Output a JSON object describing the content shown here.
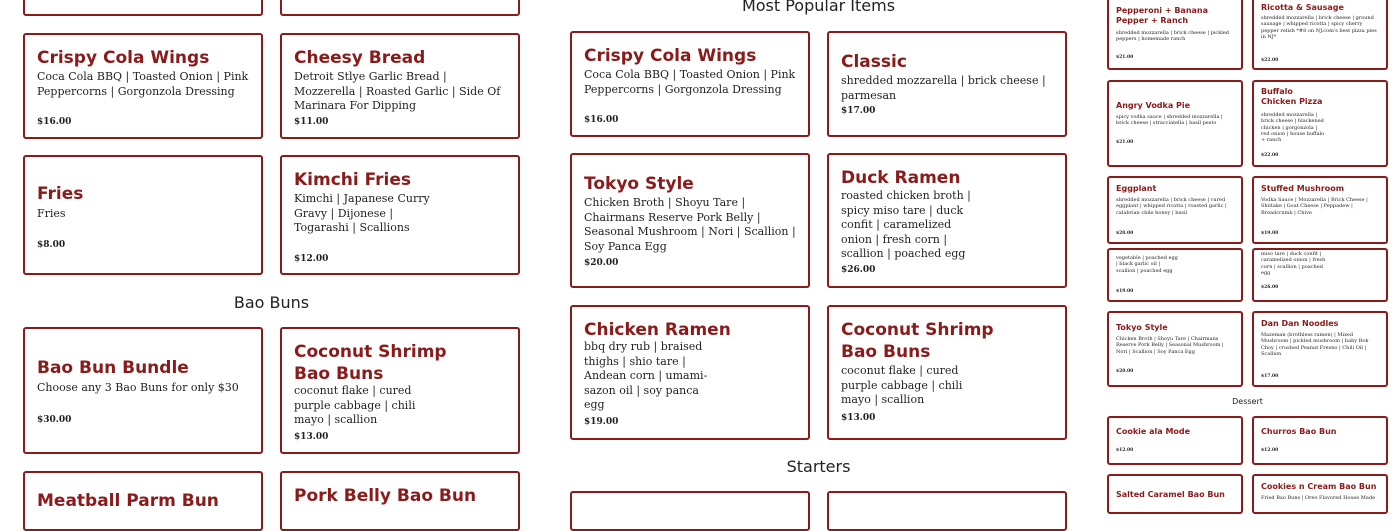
{
  "left": {
    "bao_heading": "Bao Buns",
    "cards": [
      {
        "name": "Crispy Cola Wings",
        "desc": "Coca Cola BBQ | Toasted Onion | Pink Peppercorns | Gorgonzola Dressing",
        "price": "$16.00"
      },
      {
        "name": "Cheesy Bread",
        "desc": "Detroit Stlye Garlic Bread | Mozzerella | Roasted Garlic | Side Of Marinara For Dipping",
        "price": "$11.00"
      },
      {
        "name": "Fries",
        "desc": "Fries",
        "price": "$8.00"
      },
      {
        "name": "Kimchi Fries",
        "desc": "Kimchi | Japanese Curry Gravy | Dijonese | Togarashi | Scallions",
        "price": "$12.00"
      },
      {
        "name": "Bao Bun Bundle",
        "desc": "Choose any 3 Bao Buns for only $30",
        "price": "$30.00"
      },
      {
        "name": "Coconut Shrimp Bao Buns",
        "desc": "coconut flake | cured purple cabbage | chili mayo | scallion",
        "price": "$13.00"
      },
      {
        "name": "Meatball Parm Bun",
        "desc": "",
        "price": ""
      },
      {
        "name": "Pork Belly Bao Bun",
        "desc": "",
        "price": ""
      }
    ]
  },
  "middle": {
    "popular_heading": "Most Popular Items",
    "starters_heading": "Starters",
    "cards": [
      {
        "name": "Crispy Cola Wings",
        "desc": "Coca Cola BBQ | Toasted Onion | Pink Peppercorns | Gorgonzola Dressing",
        "price": "$16.00"
      },
      {
        "name": "Classic",
        "desc": "shredded mozzarella | brick cheese | parmesan",
        "price": "$17.00"
      },
      {
        "name": "Tokyo Style",
        "desc": "Chicken Broth | Shoyu Tare | Chairmans Reserve Pork Belly | Seasonal Mushroom | Nori | Scallion | Soy Panca Egg",
        "price": "$20.00"
      },
      {
        "name": "Duck Ramen",
        "desc": "roasted chicken broth | spicy miso tare | duck confit | caramelized onion | fresh corn | scallion | poached egg",
        "price": "$26.00"
      },
      {
        "name": "Chicken Ramen",
        "desc": "bbq dry rub | braised thighs | shio tare | Andean corn | umami-sazon oil | soy panca egg",
        "price": "$19.00"
      },
      {
        "name": "Coconut Shrimp Bao Buns",
        "desc": "coconut flake | cured purple cabbage | chili mayo | scallion",
        "price": "$13.00"
      },
      {
        "name": "",
        "desc": "",
        "price": ""
      },
      {
        "name": "",
        "desc": "",
        "price": ""
      }
    ]
  },
  "right": {
    "dessert_heading": "Dessert",
    "cards": [
      {
        "name": "Pepperoni + Banana Pepper + Ranch",
        "desc": "shredded mozzarella | brick cheese | pickled peppers | homemade ranch",
        "price": "$21.00"
      },
      {
        "name": "Ricotta & Sausage",
        "desc": "shredded mozzarella | brick cheese | ground sausage | whipped ricotta | spicy cherry pepper relish *#8 on NJ.com's best pizza pies in NJ*",
        "price": "$22.00"
      },
      {
        "name": "Angry Vodka Pie",
        "desc": "spicy vodka sauce | shredded mozzarella | brick cheese | stracciatella | basil pesto",
        "price": "$21.00"
      },
      {
        "name": "Buffalo Chicken Pizza",
        "desc": "shredded mozzarella | brick cheese | blackened chicken | gorgonzola | red onion | house buffalo + ranch",
        "price": "$22.00"
      },
      {
        "name": "Eggplant",
        "desc": "shredded mozzarella | brick cheese | cured eggplant | whipped ricotta | roasted garlic | calabrian chile honey | basil",
        "price": "$20.00"
      },
      {
        "name": "Stuffed Mushroom",
        "desc": "Vodka Sauce | Mozzarella | Brick Cheese | Shiitake | Goat Cheese | Peppadew | Breadcrumb | Chive",
        "price": "$19.00"
      },
      {
        "name": "",
        "desc": "vegetable | poached egg | black garlic oil | scallion | poached egg",
        "price": "$19.00"
      },
      {
        "name": "",
        "desc": "miso tare | duck confit | caramelized onion | fresh corn | scallion | poached egg",
        "price": "$26.00"
      },
      {
        "name": "Tokyo Style",
        "desc": "Chicken Broth | Shoyu Tare | Chairmans Reserve Pork Belly | Seasonal Mushroom | Nori | Scallion | Soy Panca Egg",
        "price": "$20.00"
      },
      {
        "name": "Dan Dan Noodles",
        "desc": "Mazeman (brothless ramen) | Mixed Mushroom | pickled mushroom | baby Bok Choy | crushed Peanut Fresno | Chili Oil | Scallion",
        "price": "$17.00"
      },
      {
        "name": "Cookie ala Mode",
        "desc": "",
        "price": "$12.00"
      },
      {
        "name": "Churros Bao Bun",
        "desc": "",
        "price": "$12.00"
      },
      {
        "name": "Salted Caramel Bao Bun",
        "desc": "",
        "price": ""
      },
      {
        "name": "Cookies n Cream Bao Bun",
        "desc": "Fried Bao Buns | Oreo Flavored House Made",
        "price": ""
      }
    ]
  }
}
